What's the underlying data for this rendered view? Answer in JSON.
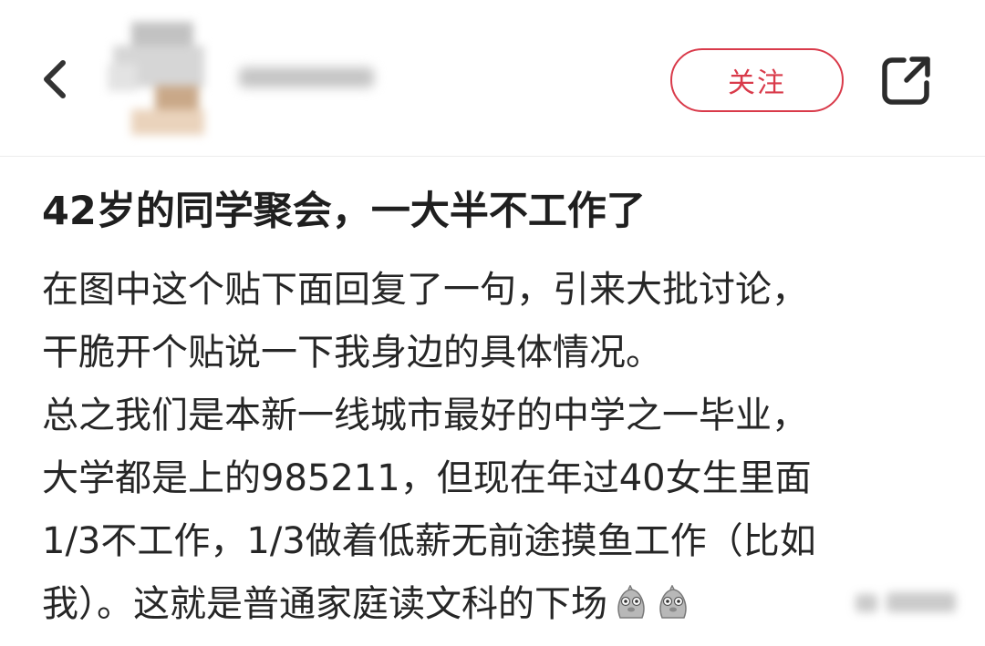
{
  "header": {
    "back_icon": "chevron-left-icon",
    "follow_label": "关注",
    "share_icon": "share-icon",
    "accent_color": "#d93a4a"
  },
  "post": {
    "title": "42岁的同学聚会，一大半不工作了",
    "lines": [
      "在图中这个贴下面回复了一句，引来大批讨论，",
      "干脆开个贴说一下我身边的具体情况。",
      "总之我们是本新一线城市最好的中学之一毕业，",
      "大学都是上的985211，但现在年过40女生里面",
      "1/3不工作，1/3做着低薪无前途摸鱼工作（比如",
      "我）。这就是普通家庭读文科的下场"
    ],
    "emoji_icon": "doge-emoji-icon"
  }
}
